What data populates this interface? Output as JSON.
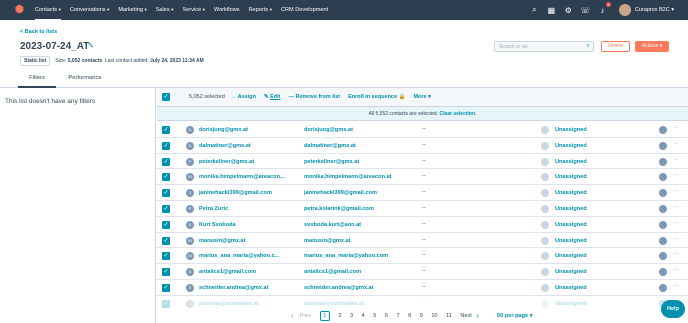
{
  "nav": {
    "items": [
      "Contacts",
      "Conversations",
      "Marketing",
      "Sales",
      "Service",
      "Workflows",
      "Reports",
      "CRM Development"
    ],
    "notif_count": "1",
    "portal_name": "Curaprox B2C"
  },
  "header": {
    "back": "< Back to lists",
    "title": "2023-07-24_AT",
    "list_type": "Static list",
    "size_label": "Size:",
    "size_value": "5,052 contacts",
    "last_added_label": "Last contact added:",
    "last_added_value": "July 24, 2023 11:34 AM",
    "search_placeholder": "Search in list",
    "delete_label": "Delete",
    "actions_label": "Actions ▾"
  },
  "tabs": [
    "Filters",
    "Performance"
  ],
  "filters": {
    "empty_text": "This list doesn't have any filters"
  },
  "toolbar": {
    "selected": "5,052 selected",
    "assign": "→ Assign",
    "edit": "Edit",
    "remove": "— Remove from list",
    "enroll": "Enroll in sequence",
    "more": "More ▾"
  },
  "banner": {
    "text": "All 5,052 contacts are selected.",
    "clear": "Clear selection."
  },
  "rows": [
    {
      "initial": "D",
      "name": "dorisjung@gmx.at",
      "email": "dorisjung@gmx.at",
      "dash": "--",
      "status": "Unassigned"
    },
    {
      "initial": "D",
      "name": "dalmatiner@gmx.at",
      "email": "dalmatiner@gmx.at",
      "dash": "--",
      "status": "Unassigned"
    },
    {
      "initial": "P",
      "name": "peterkellner@gmx.at",
      "email": "peterkellner@gmx.at",
      "dash": "--",
      "status": "Unassigned"
    },
    {
      "initial": "M",
      "name": "monika.himpelmann@areacon...",
      "email": "monika.himpelmann@areacon.at",
      "dash": "--",
      "status": "Unassigned"
    },
    {
      "initial": "J",
      "name": "janinehackl399@gmail.com",
      "email": "janinehackl399@gmail.com",
      "dash": "--",
      "status": "Unassigned"
    },
    {
      "initial": "P",
      "name": "Petra Zuric",
      "email": "petra.kolarink@gmail.com",
      "dash": "--",
      "status": "Unassigned"
    },
    {
      "initial": "K",
      "name": "Kurt Svoboda",
      "email": "svoboda.kurt@aon.at",
      "dash": "--",
      "status": "Unassigned"
    },
    {
      "initial": "M",
      "name": "manusin@gmx.at",
      "email": "manusin@gmx.at",
      "dash": "--",
      "status": "Unassigned"
    },
    {
      "initial": "M",
      "name": "marius_ana_maria@yahoo.c...",
      "email": "marius_ana_maria@yahoo.com",
      "dash": "--",
      "status": "Unassigned"
    },
    {
      "initial": "A",
      "name": "antalics1@gmail.com",
      "email": "antalics1@gmail.com",
      "dash": "--",
      "status": "Unassigned"
    },
    {
      "initial": "S",
      "name": "schneider.andrea@gmx.at",
      "email": "schneider.andrea@gmx.at",
      "dash": "--",
      "status": "Unassigned"
    },
    {
      "initial": "A",
      "name": "andreas@schneider.at",
      "email": "andreas@schneider.at",
      "dash": "--",
      "status": "Unassigned"
    }
  ],
  "pager": {
    "prev": "Prev",
    "pages": [
      "1",
      "2",
      "3",
      "4",
      "5",
      "6",
      "7",
      "8",
      "9",
      "10",
      "11"
    ],
    "current": "1",
    "next": "Next",
    "per_page": "50 per page ▾"
  },
  "help": "Help",
  "colors": {
    "nav_bg": "#2d3e50",
    "accent": "#ff7a59",
    "link": "#0091ae"
  }
}
